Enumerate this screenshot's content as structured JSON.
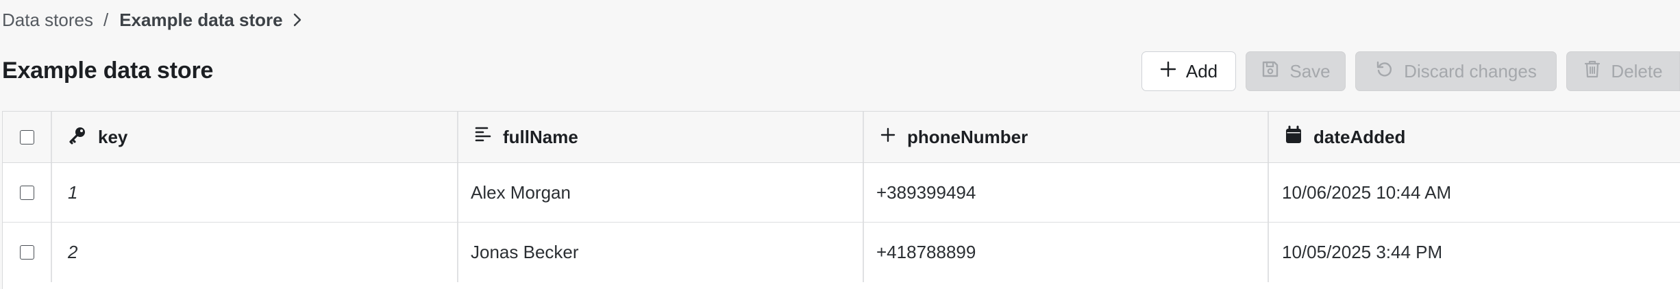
{
  "breadcrumb": {
    "root": "Data stores",
    "separator": "/",
    "current": "Example data store"
  },
  "page": {
    "title": "Example data store"
  },
  "toolbar": {
    "add_label": "Add",
    "save_label": "Save",
    "discard_label": "Discard changes",
    "delete_label": "Delete"
  },
  "table": {
    "columns": [
      {
        "label": "key",
        "icon": "key-icon"
      },
      {
        "label": "fullName",
        "icon": "text-icon"
      },
      {
        "label": "phoneNumber",
        "icon": "plus-icon"
      },
      {
        "label": "dateAdded",
        "icon": "calendar-icon"
      }
    ],
    "rows": [
      {
        "key": "1",
        "fullName": "Alex Morgan",
        "phoneNumber": "+389399494",
        "dateAdded": "10/06/2025 10:44 AM"
      },
      {
        "key": "2",
        "fullName": "Jonas Becker",
        "phoneNumber": "+418788899",
        "dateAdded": "10/05/2025 3:44 PM"
      }
    ]
  },
  "colors": {
    "background": "#f7f7f7",
    "disabled_button": "#d8d9db",
    "disabled_text": "#a5a8ac",
    "border": "#d9dadc"
  }
}
